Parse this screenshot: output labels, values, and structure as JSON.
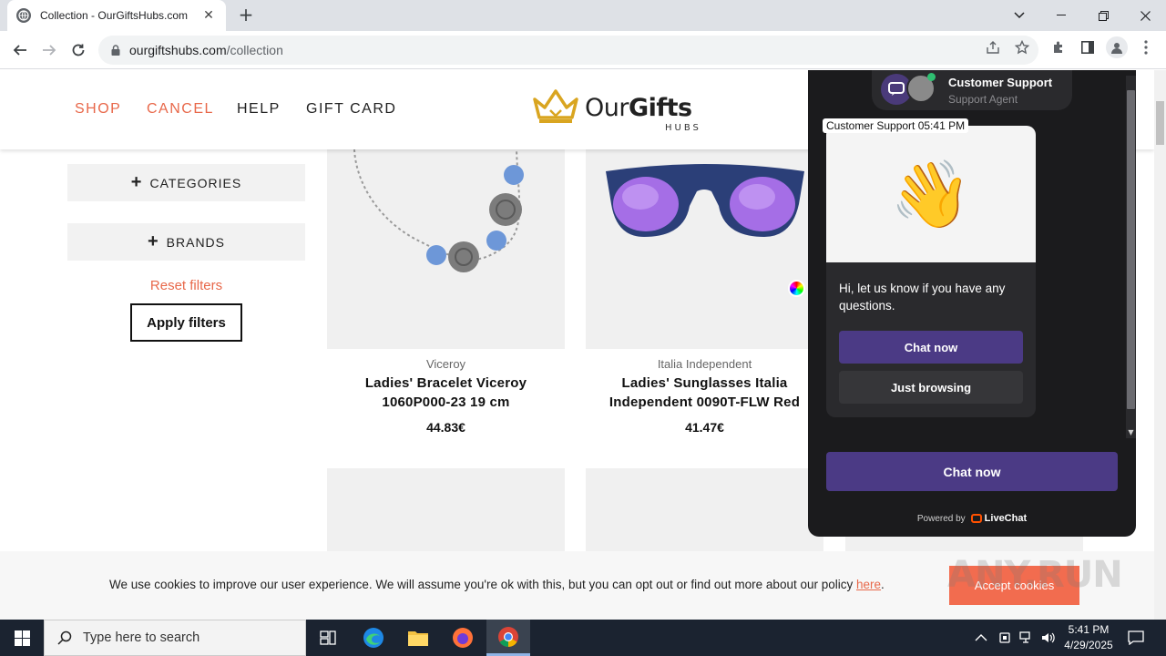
{
  "browser": {
    "tab_title": "Collection - OurGiftsHubs.com",
    "tab_close": "✕",
    "new_tab": "+",
    "url_domain": "ourgiftshubs.com",
    "url_path": "/collection",
    "window_controls": [
      "chevron-down",
      "minimize",
      "restore",
      "close"
    ]
  },
  "site": {
    "nav": [
      {
        "label": "SHOP",
        "color": "#e8684a"
      },
      {
        "label": "CANCEL",
        "color": "#e8684a"
      },
      {
        "label": "HELP",
        "color": "#222222"
      },
      {
        "label": "GIFT CARD",
        "color": "#222222"
      }
    ],
    "logo_brand_light": "Our",
    "logo_brand_bold": "Gifts",
    "logo_sub": "HUBS"
  },
  "filters": {
    "categories_label": "CATEGORIES",
    "brands_label": "BRANDS",
    "plus_glyph": "+",
    "reset_label": "Reset filters",
    "apply_label": "Apply filters"
  },
  "products": [
    {
      "brand": "Viceroy",
      "name_line1": "Ladies' Bracelet Viceroy",
      "name_line2": "1060P000-23 19 cm",
      "price": "44.83€"
    },
    {
      "brand": "Italia Independent",
      "name_line1": "Ladies' Sunglasses Italia",
      "name_line2": "Independent 0090T-FLW Red",
      "price": "41.47€"
    }
  ],
  "cookie": {
    "text": "We use cookies to improve our user experience. We will assume you're ok with this, but you can opt out or find out more about our policy ",
    "link": "here",
    "period": ".",
    "accept": "Accept cookies"
  },
  "watermark": "ANY.RUN",
  "chat": {
    "agent_name": "Customer Support",
    "agent_role": "Support Agent",
    "meta": "Customer Support  05:41 PM",
    "emoji": "👋",
    "message": "Hi, let us know if you have any questions.",
    "primary_button": "Chat now",
    "secondary_button": "Just browsing",
    "bottom_button": "Chat now",
    "powered_by": "Powered by",
    "powered_brand": "LiveChat",
    "accent_color": "#4b3a85"
  },
  "taskbar": {
    "search_placeholder": "Type here to search",
    "time": "5:41 PM",
    "date": "4/29/2025"
  }
}
